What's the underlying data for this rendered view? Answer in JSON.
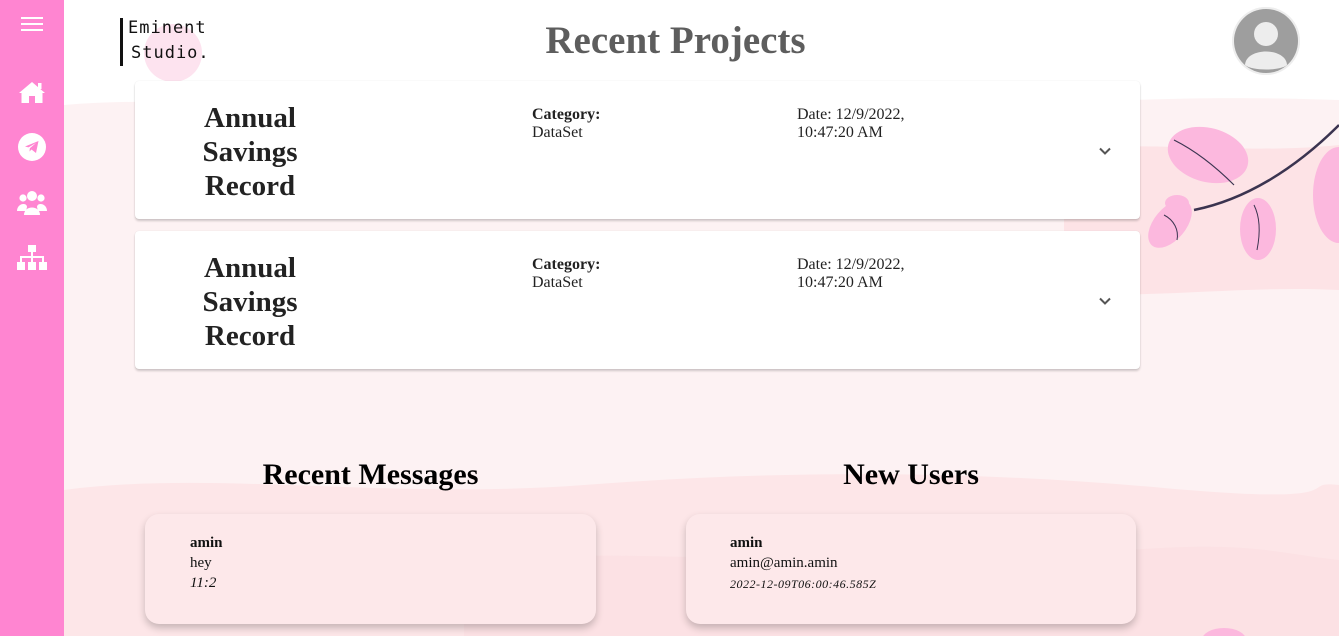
{
  "brand": {
    "logo_line1": "Eminent",
    "logo_line2": "Studio."
  },
  "page": {
    "title": "Recent Projects"
  },
  "sidebar": {
    "items": [
      {
        "icon": "menu-icon"
      },
      {
        "icon": "home-icon"
      },
      {
        "icon": "telegram-icon"
      },
      {
        "icon": "users-icon"
      },
      {
        "icon": "sitemap-icon"
      }
    ]
  },
  "projects": [
    {
      "title": "Annual Savings Record",
      "category_label": "Category:",
      "category": "DataSet",
      "date_line1": "Date: 12/9/2022,",
      "date_line2": "10:47:20 AM"
    },
    {
      "title": "Annual Savings Record",
      "category_label": "Category:",
      "category": "DataSet",
      "date_line1": "Date: 12/9/2022,",
      "date_line2": "10:47:20 AM"
    }
  ],
  "messages": {
    "title": "Recent Messages",
    "items": [
      {
        "name": "amin",
        "text": "hey",
        "time": "11:2"
      }
    ]
  },
  "users": {
    "title": "New Users",
    "items": [
      {
        "name": "amin",
        "email": "amin@amin.amin",
        "created": "2022-12-09T06:00:46.585Z"
      }
    ]
  },
  "colors": {
    "sidebar": "#ff85d1",
    "accent_pink": "#fcb8de",
    "panel": "#fde8ea",
    "title_gray": "#5d5d5d"
  }
}
